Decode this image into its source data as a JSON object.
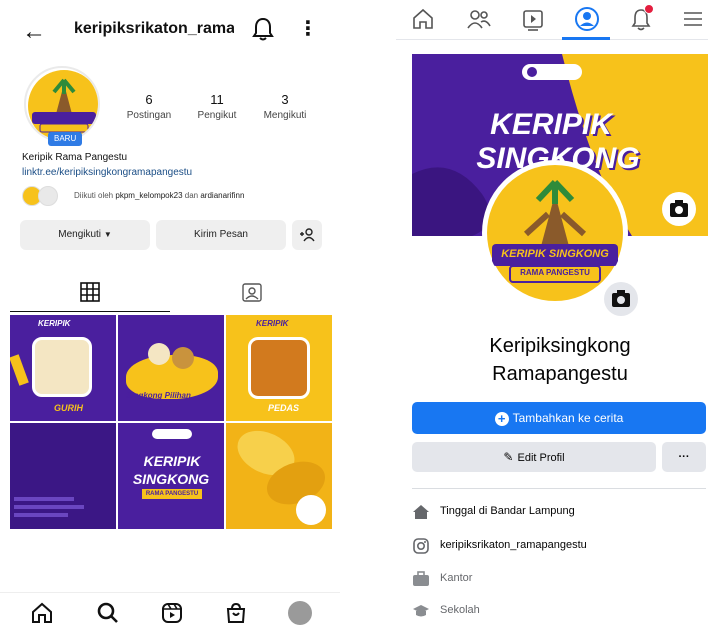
{
  "instagram": {
    "username": "keripiksrikaton_ramap...",
    "badge": "BARU",
    "stats": [
      {
        "value": "6",
        "label": "Postingan"
      },
      {
        "value": "11",
        "label": "Pengikut"
      },
      {
        "value": "3",
        "label": "Mengikuti"
      }
    ],
    "bio_name": "Keripik Rama Pangestu",
    "bio_link": "linktr.ee/keripiksingkongramapangestu",
    "followed_by_prefix": "Diikuti oleh",
    "followed_by_user1": "pkpm_kelompok23",
    "followed_by_and": "dan",
    "followed_by_user2": "ardianarifinn",
    "buttons": {
      "following": "Mengikuti",
      "message": "Kirim Pesan"
    },
    "logo": {
      "line1": "KERIPIK SINGKONG",
      "line2": "RAMA PANGESTU"
    },
    "posts": [
      {
        "top": "KERIPIK",
        "caption": "GURIH"
      },
      {
        "top": "",
        "caption": "Singkong Pilihan"
      },
      {
        "top": "KERIPIK",
        "caption": "PEDAS"
      },
      {
        "top": "",
        "caption": ""
      },
      {
        "top": "KERIPIK",
        "caption": "SINGKONG"
      },
      {
        "top": "",
        "caption": ""
      }
    ],
    "post5_sub": "RAMA PANGESTU"
  },
  "facebook": {
    "cover_title_1": "KERIPIK",
    "cover_title_2": "SINGKONG",
    "logo_line1": "KERIPIK SINGKONG",
    "logo_line2": "RAMA PANGESTU",
    "name_line1": "Keripiksingkong",
    "name_line2": "Ramapangestu",
    "add_story": "Tambahkan ke cerita",
    "edit_profile": "Edit Profil",
    "more": "···",
    "info": [
      {
        "prefix": "Tinggal di",
        "value": "Bandar Lampung"
      },
      {
        "prefix": "",
        "value": "keripiksrikaton_ramapangestu"
      },
      {
        "prefix": "",
        "value": "Kantor"
      },
      {
        "prefix": "",
        "value": "Sekolah"
      }
    ]
  },
  "colors": {
    "purple": "#4a1f9e",
    "yellow": "#f7c21b",
    "fb_blue": "#1877f2",
    "ig_blue": "#2f7be5"
  }
}
